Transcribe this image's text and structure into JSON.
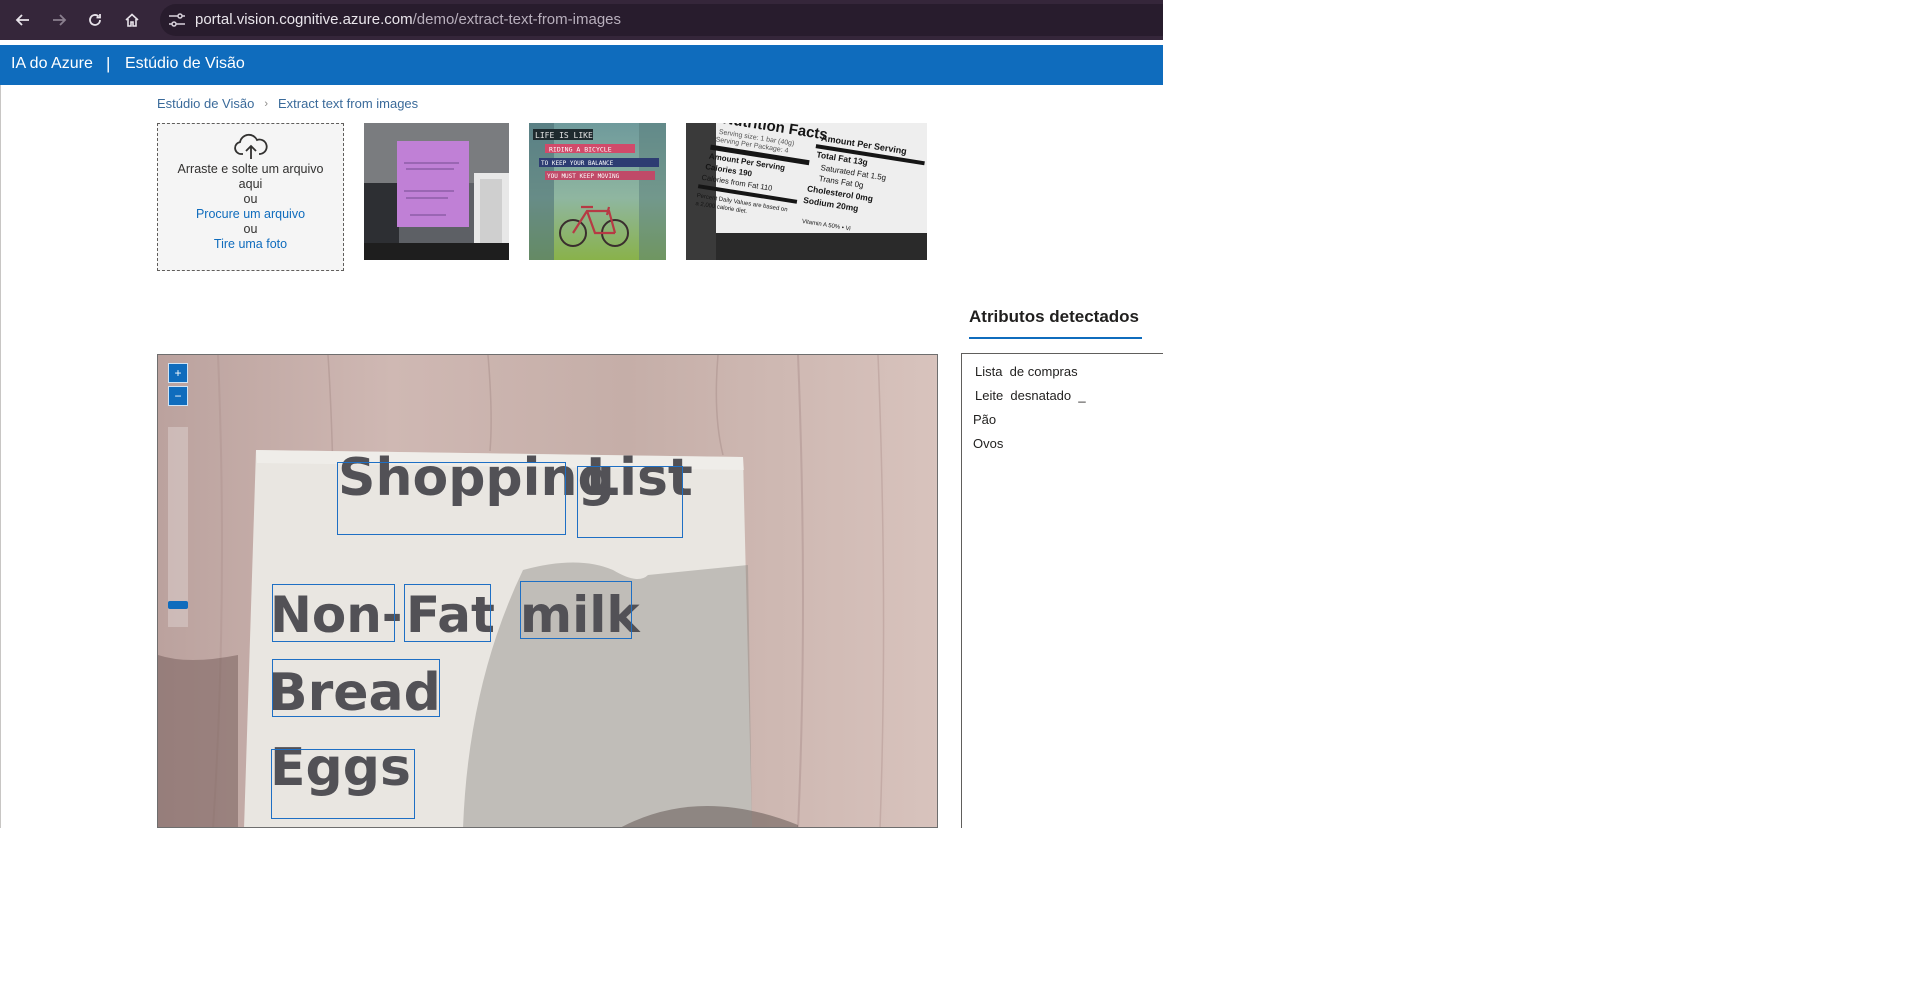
{
  "browser": {
    "url_host": "portal.vision.cognitive.azure.com",
    "url_path": "/demo/extract-text-from-images"
  },
  "header": {
    "brand": "IA do Azure",
    "separator": "|",
    "studio": "Estúdio de Visão"
  },
  "breadcrumb": {
    "home": "Estúdio de Visão",
    "current": "Extract text from images"
  },
  "upload": {
    "drag_text_1": "Arraste e solte um arquivo",
    "drag_text_2": "aqui",
    "or_1": "ou",
    "browse": "Procure um arquivo",
    "or_2": "ou",
    "take_photo": "Tire uma foto"
  },
  "samples": [
    {
      "icon": "sticky-note-photo"
    },
    {
      "icon": "bicycle-poster-photo",
      "lines": [
        "LIFE IS LIKE",
        "RIDING A BICYCLE",
        "TO KEEP YOUR BALANCE",
        "YOU MUST KEEP MOVING"
      ]
    },
    {
      "icon": "nutrition-facts-photo",
      "lines": [
        "Nutrition Facts",
        "Serving size: 1 bar (40g)",
        "Serving Per Package: 4",
        "Amount Per Serving",
        "Calories 190",
        "Calories from Fat 110",
        "Amount Per Serving",
        "Total Fat 13g",
        "Saturated Fat 1.5g",
        "Trans Fat 0g",
        "Cholesterol 0mg",
        "Sodium 20mg",
        "Percent Daily Values are based on",
        "a 2,000 calorie diet.",
        "Vitamin A 50% • Vi"
      ]
    }
  ],
  "viewer": {
    "zoom_in": "+",
    "zoom_out": "−",
    "note_lines": {
      "shopping": "Shopping",
      "list": "List",
      "non": "Non-",
      "fat": "Fat",
      "milk": "milk",
      "bread": "Bread",
      "eggs": "Eggs"
    }
  },
  "attributes": {
    "title": "Atributos detectados",
    "lines": [
      "Lista  de compras",
      "Leite  desnatado  _",
      "Pão",
      "Ovos"
    ]
  },
  "colors": {
    "browser_bar": "#35263a",
    "azure_blue": "#0f6cbd",
    "bbox": "#1e6fc4"
  }
}
